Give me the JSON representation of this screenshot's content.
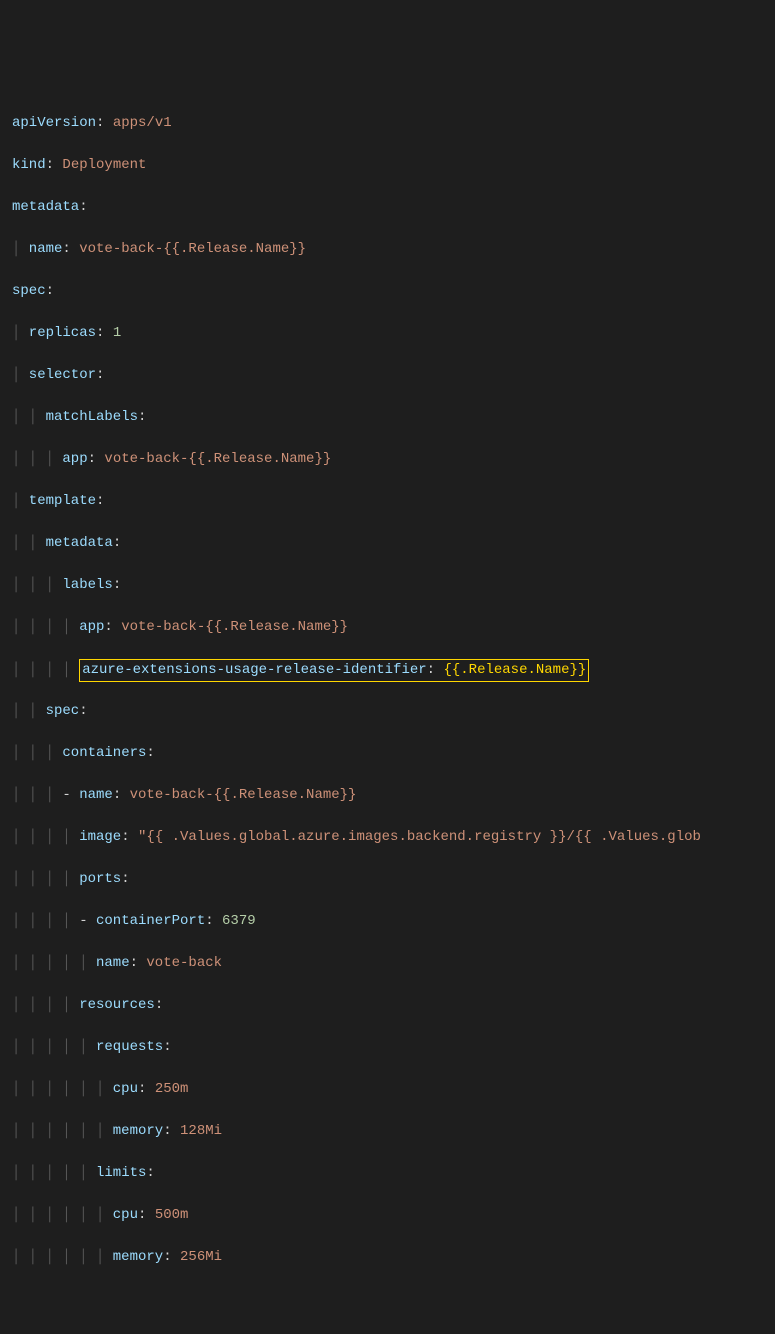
{
  "code_lines": {
    "l1_key": "apiVersion",
    "l1_val": "apps/v1",
    "l2_key": "kind",
    "l2_val": "Deployment",
    "l3_key": "metadata",
    "l4_key": "name",
    "l4_val": "vote-back-{{.Release.Name}}",
    "l5_key": "spec",
    "l6_key": "replicas",
    "l6_val": "1",
    "l7_key": "selector",
    "l8_key": "matchLabels",
    "l9_key": "app",
    "l9_val": "vote-back-{{.Release.Name}}",
    "l10_key": "template",
    "l11_key": "metadata",
    "l12_key": "labels",
    "l13_key": "app",
    "l13_val": "vote-back-{{.Release.Name}}",
    "l14_key": "azure-extensions-usage-release-identifier",
    "l14_val": "{{.Release.Name}}",
    "l15_key": "spec",
    "l16_key": "containers",
    "l17_key": "name",
    "l17_val": "vote-back-{{.Release.Name}}",
    "l18_key": "image",
    "l18_val": "\"{{ .Values.global.azure.images.backend.registry }}/{{ .Values.glob",
    "l19_key": "ports",
    "l20_key": "containerPort",
    "l20_val": "6379",
    "l21_key": "name",
    "l21_val": "vote-back",
    "l22_key": "resources",
    "l23_key": "requests",
    "l24_key": "cpu",
    "l24_val": "250m",
    "l25_key": "memory",
    "l25_val": "128Mi",
    "l26_key": "limits",
    "l27_key": "cpu",
    "l27_val": "500m",
    "l28_key": "memory",
    "l28_val": "256Mi"
  }
}
